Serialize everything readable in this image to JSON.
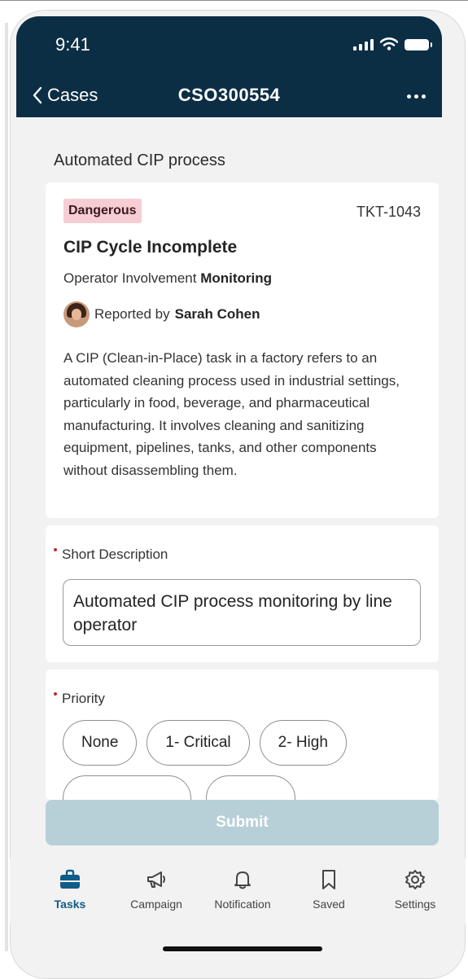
{
  "status_bar": {
    "time": "9:41"
  },
  "nav": {
    "back_label": "Cases",
    "title": "CSO300554"
  },
  "section_heading": "Automated CIP process",
  "ticket": {
    "badge": "Dangerous",
    "id": "TKT-1043",
    "title": "CIP Cycle Incomplete",
    "involvement_label": "Operator Involvement",
    "involvement_value": "Monitoring",
    "reported_by_label": "Reported by",
    "reporter_name": "Sarah Cohen",
    "description": "A CIP (Clean-in-Place) task in a factory refers to an automated cleaning process used in industrial settings, particularly in food, beverage, and pharmaceutical manufacturing. It involves cleaning and sanitizing equipment, pipelines, tanks, and other components without disassembling them."
  },
  "short_description": {
    "label": "Short Description",
    "value": "Automated CIP process monitoring by line operator"
  },
  "priority": {
    "label": "Priority",
    "options": [
      "None",
      "1- Critical",
      "2- High"
    ]
  },
  "submit_label": "Submit",
  "tabs": [
    {
      "label": "Tasks",
      "icon": "briefcase-icon",
      "active": true
    },
    {
      "label": "Campaign",
      "icon": "megaphone-icon",
      "active": false
    },
    {
      "label": "Notification",
      "icon": "bell-icon",
      "active": false
    },
    {
      "label": "Saved",
      "icon": "bookmark-icon",
      "active": false
    },
    {
      "label": "Settings",
      "icon": "gear-icon",
      "active": false
    }
  ],
  "colors": {
    "header_bg": "#0b2e45",
    "badge_bg": "#f6cdd3",
    "submit_bg": "#b7d0d8",
    "active_tab": "#0f5c88",
    "required": "#c4262e"
  }
}
